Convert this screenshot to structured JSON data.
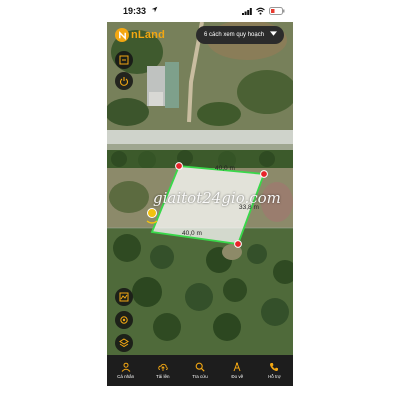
{
  "status_bar": {
    "time": "19:33"
  },
  "header": {
    "brand": "nLand",
    "mode_select": "6 cách xem quy hoạch"
  },
  "map": {
    "edge_top": "40,0 m",
    "edge_right": "33,8 m",
    "edge_bottom": "40,0 m",
    "watermark": "giaitot24gio.com",
    "colors": {
      "outline": "#39d84a",
      "vertex": "#e8232a",
      "pin": "#f3c20f"
    }
  },
  "left_controls": [
    "scan-icon",
    "power-icon"
  ],
  "right_controls": [
    "layers-icon",
    "locate-icon",
    "stack-icon"
  ],
  "tabs": [
    {
      "label": "Cá nhân",
      "icon": "person-icon"
    },
    {
      "label": "Tải lên",
      "icon": "upload-icon"
    },
    {
      "label": "Tra cứu",
      "icon": "search-icon"
    },
    {
      "label": "Đo vẽ",
      "icon": "measure-icon"
    },
    {
      "label": "Hỗ trợ",
      "icon": "phone-icon"
    }
  ]
}
